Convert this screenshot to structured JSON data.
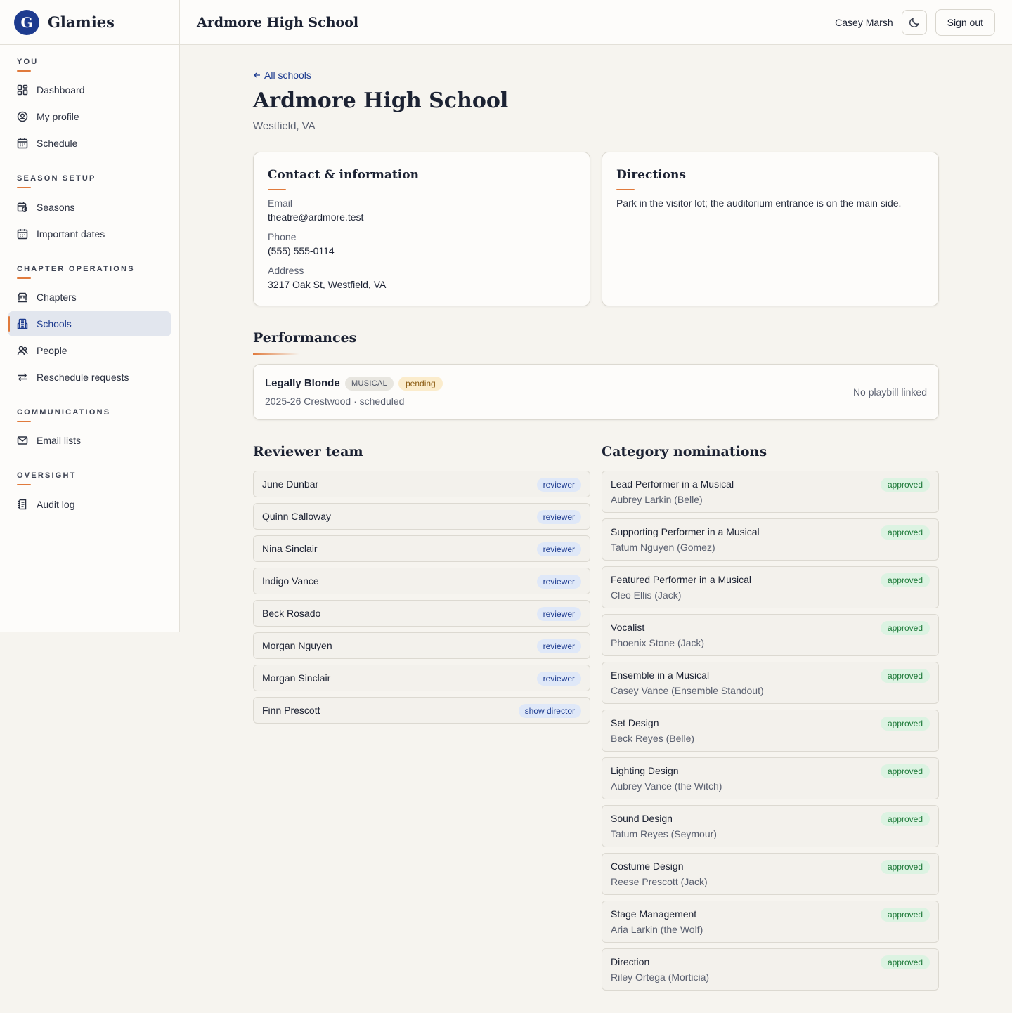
{
  "brand": {
    "name": "Glamies",
    "logo_letter": "G"
  },
  "sidebar": {
    "sections": [
      {
        "label": "YOU",
        "items": [
          {
            "label": "Dashboard",
            "icon": "dashboard-icon"
          },
          {
            "label": "My profile",
            "icon": "user-circle-icon"
          },
          {
            "label": "Schedule",
            "icon": "calendar-icon"
          }
        ]
      },
      {
        "label": "SEASON SETUP",
        "items": [
          {
            "label": "Seasons",
            "icon": "calendar-clock-icon"
          },
          {
            "label": "Important dates",
            "icon": "calendar-icon"
          }
        ]
      },
      {
        "label": "CHAPTER OPERATIONS",
        "items": [
          {
            "label": "Chapters",
            "icon": "chapters-icon"
          },
          {
            "label": "Schools",
            "icon": "school-icon",
            "active": true
          },
          {
            "label": "People",
            "icon": "people-icon"
          },
          {
            "label": "Reschedule requests",
            "icon": "swap-icon"
          }
        ]
      },
      {
        "label": "COMMUNICATIONS",
        "items": [
          {
            "label": "Email lists",
            "icon": "mail-icon"
          }
        ]
      },
      {
        "label": "OVERSIGHT",
        "items": [
          {
            "label": "Audit log",
            "icon": "log-icon"
          }
        ]
      }
    ]
  },
  "header": {
    "title": "Ardmore High School",
    "user_name": "Casey Marsh",
    "theme_icon": "moon-icon",
    "signout_label": "Sign out"
  },
  "main": {
    "back_label": "All schools",
    "title": "Ardmore High School",
    "location": "Westfield, VA",
    "contact": {
      "title": "Contact & information",
      "email_label": "Email",
      "email": "theatre@ardmore.test",
      "phone_label": "Phone",
      "phone": "(555) 555-0114",
      "address_label": "Address",
      "address": "3217 Oak St, Westfield, VA"
    },
    "directions": {
      "title": "Directions",
      "text": "Park in the visitor lot; the auditorium entrance is on the main side."
    },
    "performances": {
      "title": "Performances",
      "items": [
        {
          "title": "Legally Blonde",
          "type_badge": "MUSICAL",
          "status_badge": "pending",
          "meta": "2025-26 Crestwood · scheduled",
          "playbill": "No playbill linked"
        }
      ]
    },
    "reviewers": {
      "title": "Reviewer team",
      "items": [
        {
          "name": "June Dunbar",
          "role": "reviewer"
        },
        {
          "name": "Quinn Calloway",
          "role": "reviewer"
        },
        {
          "name": "Nina Sinclair",
          "role": "reviewer"
        },
        {
          "name": "Indigo Vance",
          "role": "reviewer"
        },
        {
          "name": "Beck Rosado",
          "role": "reviewer"
        },
        {
          "name": "Morgan Nguyen",
          "role": "reviewer"
        },
        {
          "name": "Morgan Sinclair",
          "role": "reviewer"
        },
        {
          "name": "Finn Prescott",
          "role": "show director"
        }
      ]
    },
    "nominations": {
      "title": "Category nominations",
      "items": [
        {
          "category": "Lead Performer in a Musical",
          "nominee": "Aubrey Larkin (Belle)",
          "status": "approved"
        },
        {
          "category": "Supporting Performer in a Musical",
          "nominee": "Tatum Nguyen (Gomez)",
          "status": "approved"
        },
        {
          "category": "Featured Performer in a Musical",
          "nominee": "Cleo Ellis (Jack)",
          "status": "approved"
        },
        {
          "category": "Vocalist",
          "nominee": "Phoenix Stone (Jack)",
          "status": "approved"
        },
        {
          "category": "Ensemble in a Musical",
          "nominee": "Casey Vance (Ensemble Standout)",
          "status": "approved"
        },
        {
          "category": "Set Design",
          "nominee": "Beck Reyes (Belle)",
          "status": "approved"
        },
        {
          "category": "Lighting Design",
          "nominee": "Aubrey Vance (the Witch)",
          "status": "approved"
        },
        {
          "category": "Sound Design",
          "nominee": "Tatum Reyes (Seymour)",
          "status": "approved"
        },
        {
          "category": "Costume Design",
          "nominee": "Reese Prescott (Jack)",
          "status": "approved"
        },
        {
          "category": "Stage Management",
          "nominee": "Aria Larkin (the Wolf)",
          "status": "approved"
        },
        {
          "category": "Direction",
          "nominee": "Riley Ortega (Morticia)",
          "status": "approved"
        }
      ]
    }
  }
}
